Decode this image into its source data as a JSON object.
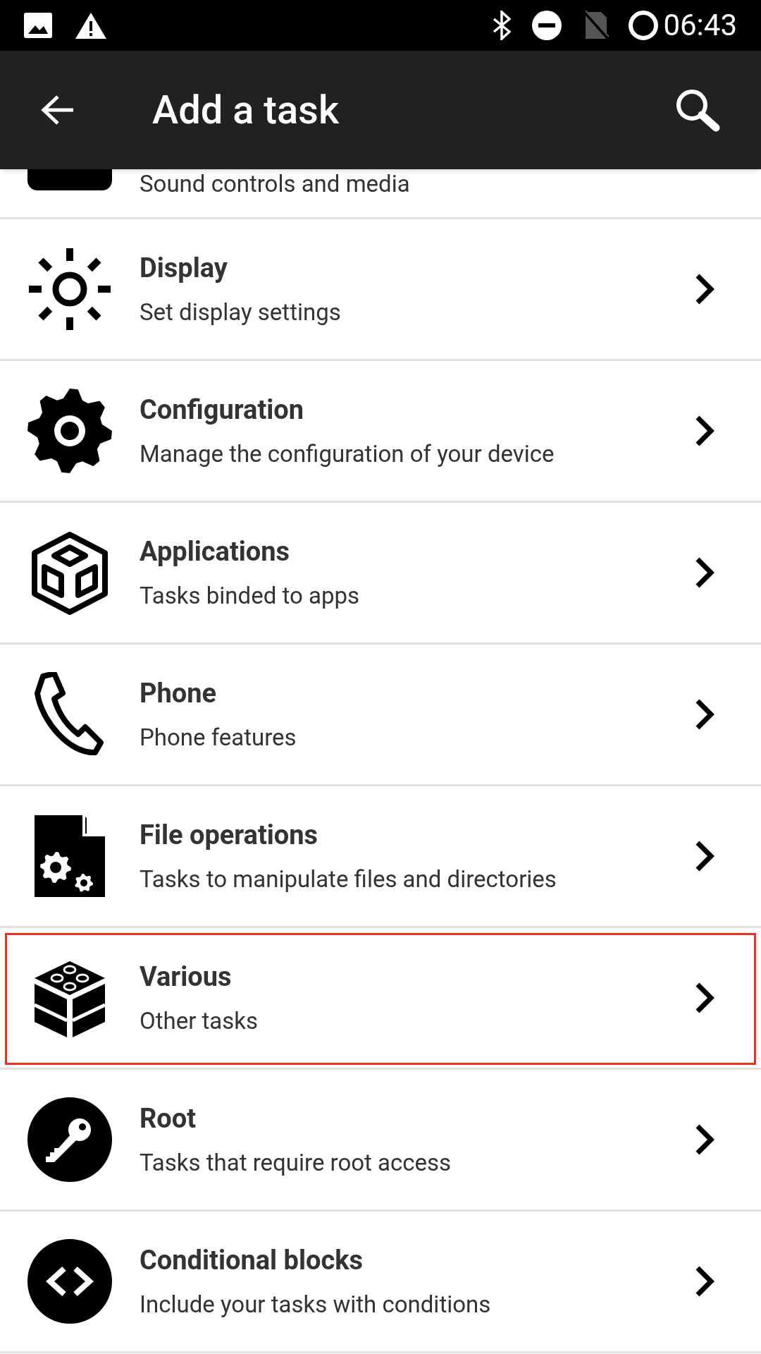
{
  "status_bar": {
    "time": "06:43"
  },
  "app_bar": {
    "title": "Add a task"
  },
  "partial_item": {
    "subtitle": "Sound controls and media"
  },
  "items": [
    {
      "kind": "display",
      "title": "Display",
      "subtitle": "Set display settings",
      "highlighted": false
    },
    {
      "kind": "configuration",
      "title": "Configuration",
      "subtitle": "Manage the configuration of your device",
      "highlighted": false
    },
    {
      "kind": "applications",
      "title": "Applications",
      "subtitle": "Tasks binded to apps",
      "highlighted": false
    },
    {
      "kind": "phone",
      "title": "Phone",
      "subtitle": "Phone features",
      "highlighted": false
    },
    {
      "kind": "files",
      "title": "File operations",
      "subtitle": "Tasks to manipulate files and directories",
      "highlighted": false
    },
    {
      "kind": "various",
      "title": "Various",
      "subtitle": "Other tasks",
      "highlighted": true
    },
    {
      "kind": "root",
      "title": "Root",
      "subtitle": "Tasks that require root access",
      "highlighted": false
    },
    {
      "kind": "conditional",
      "title": "Conditional blocks",
      "subtitle": "Include your tasks with conditions",
      "highlighted": false
    }
  ]
}
